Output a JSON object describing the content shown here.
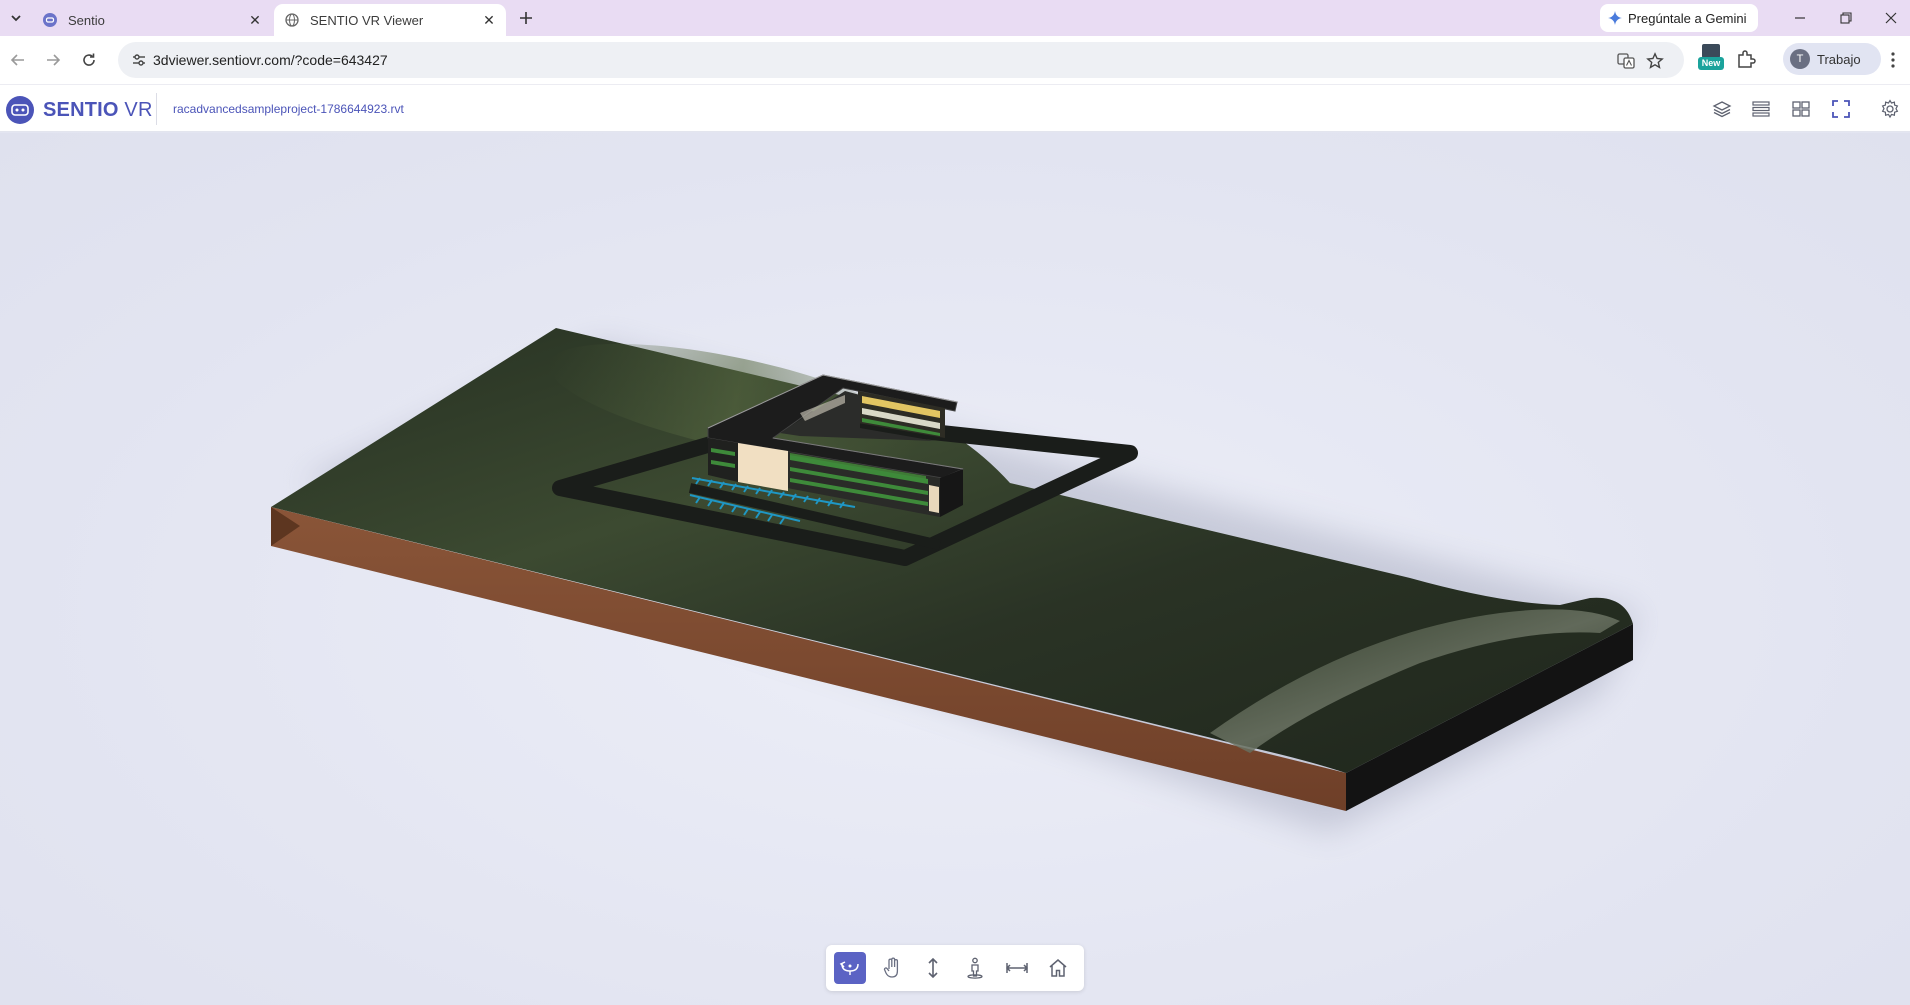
{
  "browser": {
    "tabs": [
      {
        "title": "Sentio",
        "active": false,
        "favicon": "sentio-icon"
      },
      {
        "title": "SENTIO VR Viewer",
        "active": true,
        "favicon": "globe-icon"
      }
    ],
    "url": "3dviewer.sentiovr.com/?code=643427",
    "gemini_label": "Pregúntale a Gemini",
    "profile_initial": "T",
    "profile_name": "Trabajo",
    "extension_badge": "New"
  },
  "app": {
    "brand_bold": "SENTIO",
    "brand_light": " VR",
    "file_name": "racadvancedsampleproject-1786644923.rvt",
    "accent_color": "#4b54b8",
    "header_icons": [
      "layers-icon",
      "list-icon",
      "grid-icon",
      "fullscreen-icon",
      "settings-icon"
    ]
  },
  "viewer": {
    "nav_tools": [
      {
        "name": "orbit-tool",
        "active": true
      },
      {
        "name": "pan-tool",
        "active": false
      },
      {
        "name": "vertical-move-tool",
        "active": false
      },
      {
        "name": "walk-tool",
        "active": false
      },
      {
        "name": "measure-tool",
        "active": false
      },
      {
        "name": "home-tool",
        "active": false
      }
    ]
  }
}
